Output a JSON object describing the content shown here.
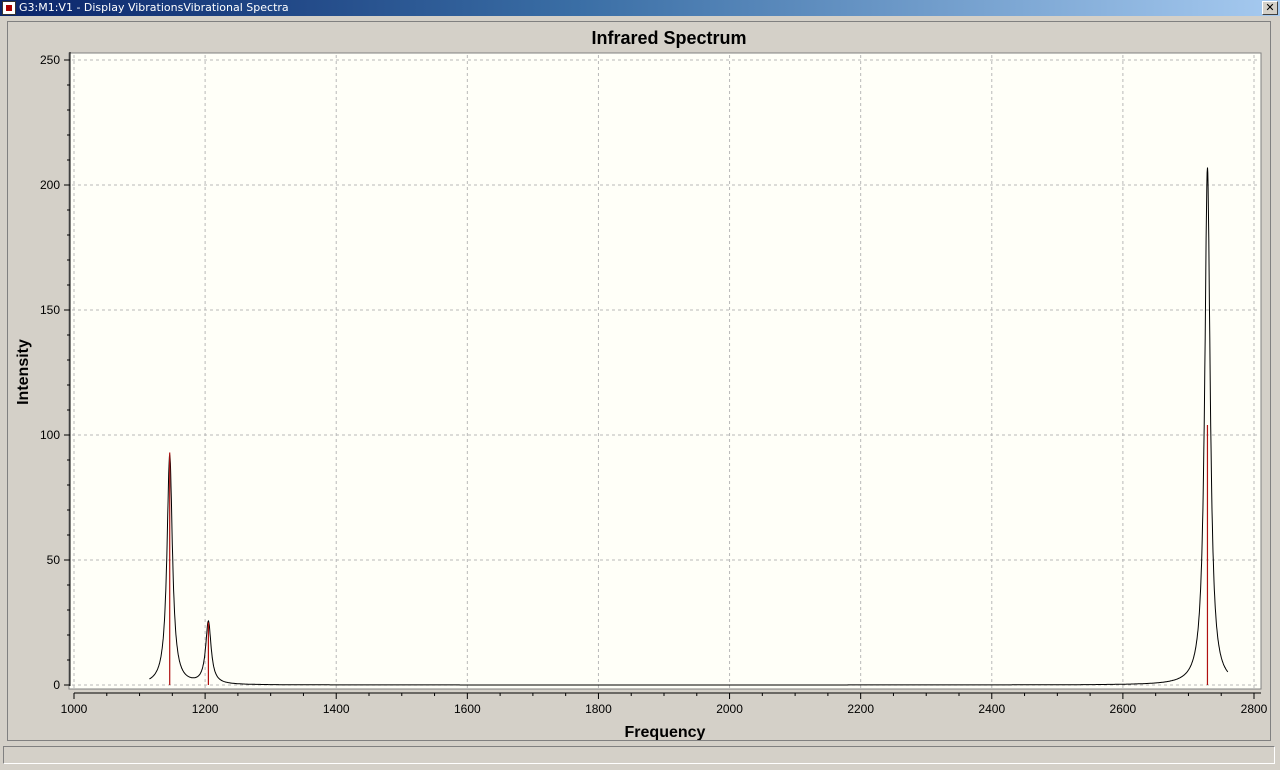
{
  "window": {
    "title": "G3:M1:V1 - Display VibrationsVibrational Spectra",
    "close_glyph": "✕"
  },
  "chart_data": {
    "type": "line",
    "title": "Infrared Spectrum",
    "xlabel": "Frequency",
    "ylabel": "Intensity",
    "xlim": [
      1000,
      2800
    ],
    "ylim": [
      0,
      250
    ],
    "x_ticks": [
      1000,
      1200,
      1400,
      1600,
      1800,
      2000,
      2200,
      2400,
      2600,
      2800
    ],
    "y_ticks": [
      0,
      50,
      100,
      150,
      200,
      250
    ],
    "grid": true,
    "colors": {
      "plot_bg": "#fffff8",
      "spectrum": "#000000",
      "sticks": "#b01010",
      "grid": "#b8b8b8"
    },
    "series": [
      {
        "kind": "spectrum",
        "x_range": [
          1115,
          2760
        ],
        "peaks": [
          {
            "x": 1146,
            "y": 92,
            "width": 10
          },
          {
            "x": 1205,
            "y": 25,
            "width": 10
          },
          {
            "x": 2729,
            "y": 207,
            "width": 10
          }
        ]
      },
      {
        "kind": "sticks",
        "x": [
          1146,
          1205,
          2729
        ],
        "values": [
          93,
          25,
          104
        ]
      }
    ]
  }
}
